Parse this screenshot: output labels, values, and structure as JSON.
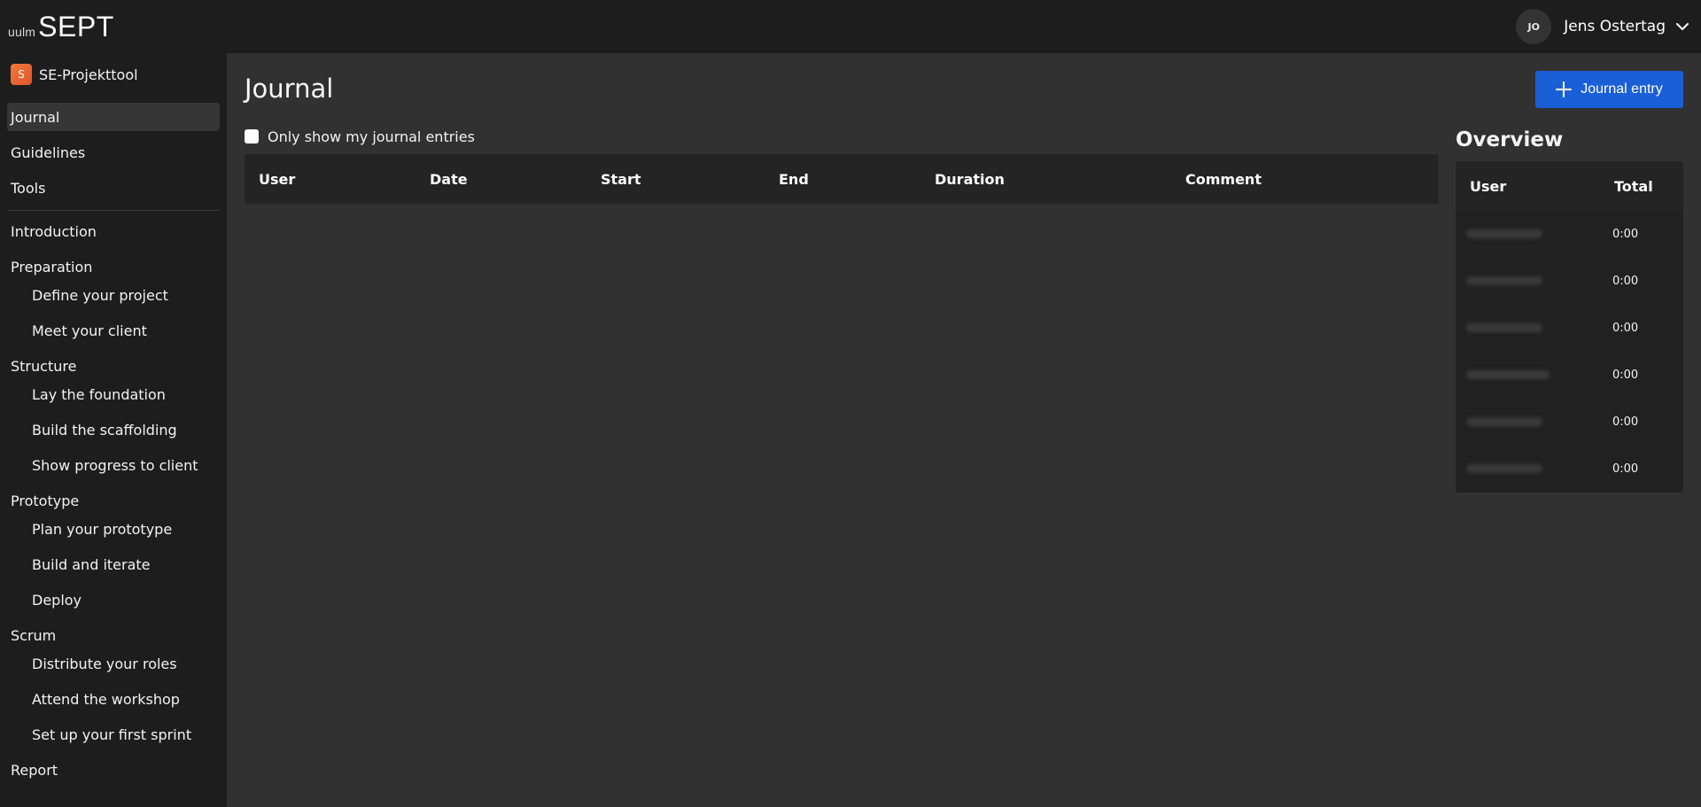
{
  "header": {
    "logo_small": "uulm",
    "logo_main": "SEPT",
    "user_initials": "JO",
    "user_name": "Jens Ostertag"
  },
  "sidebar": {
    "project_badge": "S",
    "project_name": "SE-Projekttool",
    "items": [
      {
        "label": "Journal"
      },
      {
        "label": "Guidelines"
      },
      {
        "label": "Tools"
      },
      {
        "label": "Introduction"
      },
      {
        "label": "Preparation"
      },
      {
        "label": "Define your project"
      },
      {
        "label": "Meet your client"
      },
      {
        "label": "Structure"
      },
      {
        "label": "Lay the foundation"
      },
      {
        "label": "Build the scaffolding"
      },
      {
        "label": "Show progress to client"
      },
      {
        "label": "Prototype"
      },
      {
        "label": "Plan your prototype"
      },
      {
        "label": "Build and iterate"
      },
      {
        "label": "Deploy"
      },
      {
        "label": "Scrum"
      },
      {
        "label": "Distribute your roles"
      },
      {
        "label": "Attend the workshop"
      },
      {
        "label": "Set up your first sprint"
      },
      {
        "label": "Report"
      }
    ]
  },
  "main": {
    "title": "Journal",
    "add_button_label": "Journal entry",
    "filter_label": "Only show my journal entries",
    "table_headers": [
      "User",
      "Date",
      "Start",
      "End",
      "Duration",
      "Comment"
    ]
  },
  "overview": {
    "title": "Overview",
    "headers": [
      "User",
      "Total"
    ],
    "rows": [
      {
        "total": "0:00"
      },
      {
        "total": "0:00"
      },
      {
        "total": "0:00"
      },
      {
        "total": "0:00"
      },
      {
        "total": "0:00"
      },
      {
        "total": "0:00"
      }
    ]
  },
  "colors": {
    "accent": "#1a5fd6",
    "sidebar_bg": "#1d1d1d",
    "main_bg": "#313131",
    "project_badge": "#e8632f"
  }
}
